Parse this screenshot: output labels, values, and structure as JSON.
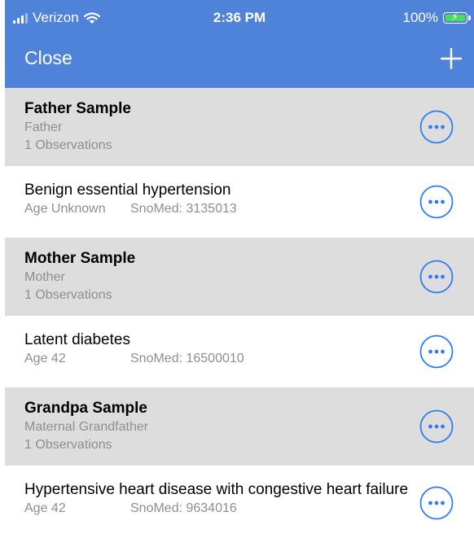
{
  "status_bar": {
    "carrier": "Verizon",
    "time": "2:36 PM",
    "battery": "100%"
  },
  "nav": {
    "close_label": "Close",
    "add_icon": "plus-icon"
  },
  "colors": {
    "nav_background": "#4f82d9",
    "accent": "#2f7cf6",
    "member_row_background": "#dddddd"
  },
  "rows": [
    {
      "type": "member",
      "name": "Father Sample",
      "relation": "Father",
      "observations": "1 Observations"
    },
    {
      "type": "condition",
      "name": "Benign essential hypertension",
      "age": "Age Unknown",
      "code": "SnoMed: 3135013"
    },
    {
      "type": "member",
      "name": "Mother Sample",
      "relation": "Mother",
      "observations": "1 Observations"
    },
    {
      "type": "condition",
      "name": "Latent diabetes",
      "age": "Age 42",
      "code": "SnoMed: 16500010"
    },
    {
      "type": "member",
      "name": "Grandpa Sample",
      "relation": "Maternal Grandfather",
      "observations": "1 Observations"
    },
    {
      "type": "condition",
      "name": "Hypertensive heart disease with congestive heart failure",
      "age": "Age 42",
      "code": "SnoMed: 9634016"
    }
  ]
}
